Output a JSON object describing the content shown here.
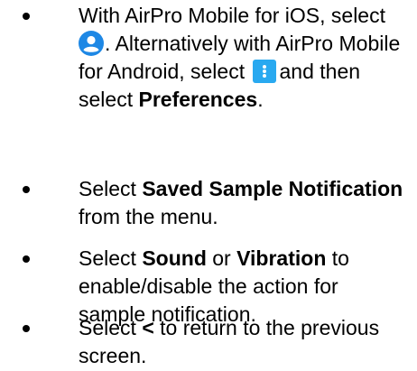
{
  "colors": {
    "accent_blue": "#1e88e5",
    "menu_icon_blue": "#29a9f0",
    "text": "#000000"
  },
  "icons": {
    "user": "user-profile-icon",
    "menu": "kebab-menu-icon"
  },
  "steps": [
    {
      "t1": "With AirPro Mobile for iOS, select",
      "t2": ". Alternatively with AirPro Mobile for Android, select",
      "t3": "and then select",
      "bold1": "Preferences",
      "t4": "."
    },
    {
      "t1": "Select",
      "bold1": "Saved Sample Notification",
      "t2": "from the menu."
    },
    {
      "t1": "Select",
      "bold1": "Sound",
      "t2": "or",
      "bold2": "Vibration",
      "t3": "to enable/disable the action for sample notification."
    },
    {
      "t1": "Select",
      "bold1": "<",
      "t2": "to return to the previous screen."
    }
  ]
}
